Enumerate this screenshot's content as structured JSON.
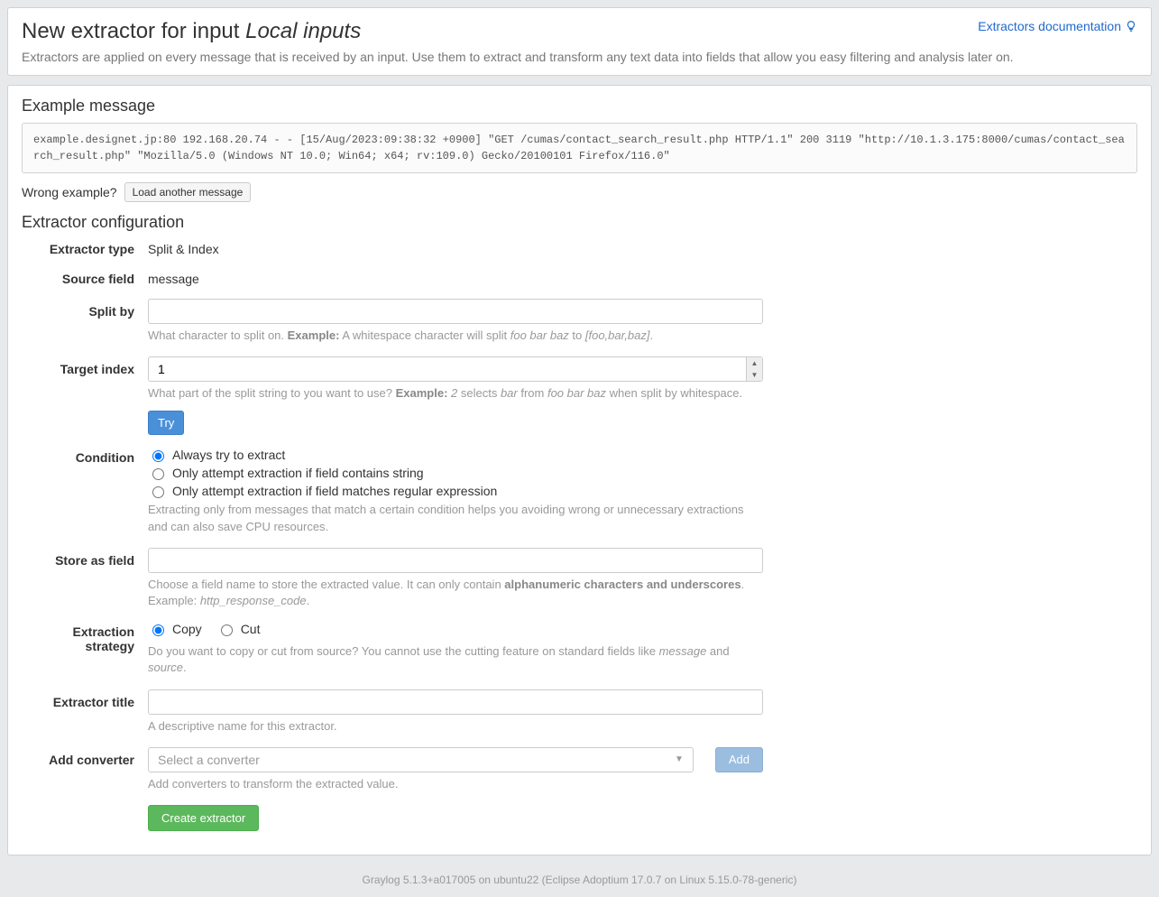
{
  "header": {
    "title_prefix": "New extractor for input ",
    "title_italic": "Local inputs",
    "subtitle": "Extractors are applied on every message that is received by an input. Use them to extract and transform any text data into fields that allow you easy filtering and analysis later on.",
    "doc_link_label": "Extractors documentation"
  },
  "example_section": {
    "heading": "Example message",
    "message": "example.designet.jp:80 192.168.20.74 - - [15/Aug/2023:09:38:32 +0900] \"GET /cumas/contact_search_result.php HTTP/1.1\" 200 3119 \"http://10.1.3.175:8000/cumas/contact_search_result.php\" \"Mozilla/5.0 (Windows NT 10.0; Win64; x64; rv:109.0) Gecko/20100101 Firefox/116.0\"",
    "wrong_label": "Wrong example?",
    "load_button": "Load another message"
  },
  "config": {
    "heading": "Extractor configuration",
    "labels": {
      "extractor_type": "Extractor type",
      "source_field": "Source field",
      "split_by": "Split by",
      "target_index": "Target index",
      "condition": "Condition",
      "store_as_field": "Store as field",
      "extraction_strategy": "Extraction strategy",
      "extractor_title": "Extractor title",
      "add_converter": "Add converter"
    },
    "values": {
      "extractor_type": "Split & Index",
      "source_field": "message",
      "split_by": "",
      "target_index": "1",
      "store_as_field": "",
      "extractor_title": ""
    },
    "split_by_help": {
      "prefix": "What character to split on. ",
      "example_label": "Example:",
      "mid": " A whitespace character will split ",
      "em1": "foo bar baz",
      "to": " to ",
      "em2": "[foo,bar,baz]",
      "suffix": "."
    },
    "target_index_help": {
      "prefix": "What part of the split string to you want to use? ",
      "example_label": "Example:",
      "em_2": " 2",
      "selects": " selects ",
      "em_bar": "bar",
      "from": " from ",
      "em_fbb": "foo bar baz",
      "suffix": " when split by whitespace."
    },
    "try_button": "Try",
    "condition_options": {
      "always": "Always try to extract",
      "contains": "Only attempt extraction if field contains string",
      "regex": "Only attempt extraction if field matches regular expression"
    },
    "condition_help": "Extracting only from messages that match a certain condition helps you avoiding wrong or unnecessary extractions and can also save CPU resources.",
    "store_help": {
      "prefix": "Choose a field name to store the extracted value. It can only contain ",
      "strong": "alphanumeric characters and underscores",
      "mid": ". Example: ",
      "em": "http_response_code",
      "suffix": "."
    },
    "strategy_options": {
      "copy": "Copy",
      "cut": "Cut"
    },
    "strategy_help": {
      "prefix": "Do you want to copy or cut from source? You cannot use the cutting feature on standard fields like ",
      "em1": "message",
      "and": " and ",
      "em2": "source",
      "suffix": "."
    },
    "title_help": "A descriptive name for this extractor.",
    "converter_placeholder": "Select a converter",
    "converter_help": "Add converters to transform the extracted value.",
    "add_button": "Add",
    "create_button": "Create extractor"
  },
  "footer": "Graylog 5.1.3+a017005 on ubuntu22 (Eclipse Adoptium 17.0.7 on Linux 5.15.0-78-generic)"
}
